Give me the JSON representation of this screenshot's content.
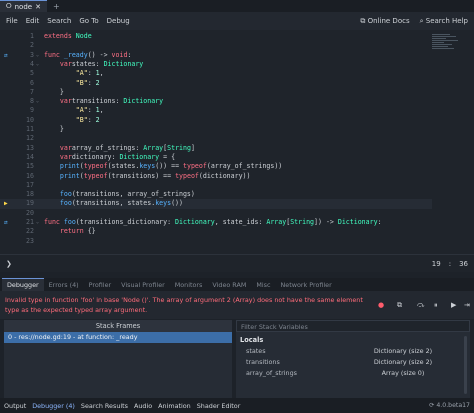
{
  "tab": {
    "title": "node"
  },
  "menu": {
    "items": [
      "File",
      "Edit",
      "Search",
      "Go To",
      "Debug"
    ],
    "online_docs": "Online Docs",
    "search_help": "Search Help"
  },
  "editor": {
    "lines": [
      {
        "n": "1",
        "tokens": [
          [
            "kw",
            "extends"
          ],
          [
            "",
            ""
          ],
          [
            "ty",
            "Node"
          ]
        ]
      },
      {
        "n": "2",
        "tokens": []
      },
      {
        "n": "3",
        "mark": "⇄",
        "fold": "v",
        "tokens": [
          [
            "kw",
            "func"
          ],
          [
            "",
            ""
          ],
          [
            "fn",
            "_ready"
          ],
          [
            "",
            "() -> "
          ],
          [
            "kw",
            "void"
          ],
          [
            "",
            ":"
          ]
        ]
      },
      {
        "n": "4",
        "fold": "v",
        "tokens": [
          [
            "",
            "    "
          ],
          [
            "kw",
            "var"
          ],
          [
            "",
            "states: "
          ],
          [
            "ty",
            "Dictionary"
          ],
          [
            "",
            ""
          ],
          [
            "",
            ""
          ],
          [
            "",
            ""
          ],
          [
            "",
            ""
          ],
          [
            "",
            ""
          ],
          [
            "",
            ""
          ],
          [
            "",
            ""
          ],
          [
            "",
            ""
          ],
          [
            "",
            ""
          ],
          [
            "",
            ""
          ],
          [
            "",
            ""
          ]
        ]
      },
      {
        "n": "5",
        "tokens": [
          [
            "",
            "        "
          ],
          [
            "st",
            "\"A\""
          ],
          [
            "",
            ": "
          ],
          [
            "nu",
            "1"
          ],
          [
            "",
            ","
          ]
        ]
      },
      {
        "n": "6",
        "tokens": [
          [
            "",
            "        "
          ],
          [
            "st",
            "\"B\""
          ],
          [
            "",
            ": "
          ],
          [
            "nu",
            "2"
          ]
        ]
      },
      {
        "n": "7",
        "tokens": [
          [
            "",
            "    }"
          ]
        ]
      },
      {
        "n": "8",
        "fold": "v",
        "tokens": [
          [
            "",
            "    "
          ],
          [
            "kw",
            "var"
          ],
          [
            "",
            "transitions: "
          ],
          [
            "ty",
            "Dictionary"
          ],
          [
            "",
            ""
          ]
        ]
      },
      {
        "n": "9",
        "tokens": [
          [
            "",
            "        "
          ],
          [
            "st",
            "\"A\""
          ],
          [
            "",
            ": "
          ],
          [
            "nu",
            "1"
          ],
          [
            "",
            ","
          ]
        ]
      },
      {
        "n": "10",
        "tokens": [
          [
            "",
            "        "
          ],
          [
            "st",
            "\"B\""
          ],
          [
            "",
            ": "
          ],
          [
            "nu",
            "2"
          ]
        ]
      },
      {
        "n": "11",
        "tokens": [
          [
            "",
            "    }"
          ]
        ]
      },
      {
        "n": "12",
        "tokens": []
      },
      {
        "n": "13",
        "tokens": [
          [
            "",
            "    "
          ],
          [
            "kw",
            "var"
          ],
          [
            "",
            "array_of_strings: "
          ],
          [
            "ty",
            "Array"
          ],
          [
            "",
            "["
          ],
          [
            "ty",
            "String"
          ],
          [
            "",
            "]"
          ]
        ]
      },
      {
        "n": "14",
        "tokens": [
          [
            "",
            "    "
          ],
          [
            "kw",
            "var"
          ],
          [
            "",
            "dictionary: "
          ],
          [
            "ty",
            "Dictionary"
          ]
        ]
      },
      {
        "n": "15",
        "tokens": [
          [
            "",
            "    "
          ],
          [
            "fn",
            "print"
          ],
          [
            "",
            "("
          ],
          [
            "kw",
            "typeof"
          ],
          [
            "",
            "(states."
          ],
          [
            "fn",
            "keys"
          ],
          [
            "",
            "()) == "
          ],
          [
            "kw",
            "typeof"
          ],
          [
            "",
            "(array_of_strings))"
          ]
        ]
      },
      {
        "n": "16",
        "tokens": [
          [
            "",
            "    "
          ],
          [
            "fn",
            "print"
          ],
          [
            "",
            "("
          ],
          [
            "kw",
            "typeof"
          ],
          [
            "",
            "(transitions) == "
          ],
          [
            "kw",
            "typeof"
          ],
          [
            "",
            "(dictionary))"
          ]
        ]
      },
      {
        "n": "17",
        "tokens": []
      },
      {
        "n": "18",
        "tokens": [
          [
            "",
            "    "
          ],
          [
            "fn",
            "foo"
          ],
          [
            "",
            "(transitions, array_of_strings)"
          ]
        ]
      },
      {
        "n": "19",
        "mark": "▶",
        "current": true,
        "tokens": [
          [
            "",
            "    "
          ],
          [
            "fn",
            "foo"
          ],
          [
            "",
            "(transitions, states."
          ],
          [
            "fn",
            "keys"
          ],
          [
            "",
            "())"
          ]
        ]
      },
      {
        "n": "20",
        "tokens": []
      },
      {
        "n": "21",
        "mark": "⇄",
        "fold": "v",
        "tokens": [
          [
            "kw",
            "func"
          ],
          [
            "",
            ""
          ],
          [
            "fn",
            "foo"
          ],
          [
            "",
            "(transitions_dictionary: "
          ],
          [
            "ty",
            "Dictionary"
          ],
          [
            "",
            ", state_ids: "
          ],
          [
            "ty",
            "Array"
          ],
          [
            "",
            "["
          ],
          [
            "ty",
            "String"
          ],
          [
            "",
            "]) -> "
          ],
          [
            "ty",
            "Dictionary"
          ],
          [
            "",
            ":"
          ]
        ]
      },
      {
        "n": "22",
        "tokens": [
          [
            "",
            "    "
          ],
          [
            "kw",
            "return"
          ],
          [
            "",
            ""
          ],
          [
            "",
            "{}"
          ]
        ]
      },
      {
        "n": "23",
        "tokens": []
      }
    ]
  },
  "status": {
    "line": "19",
    "col": "36"
  },
  "debugger_tabs": [
    "Debugger",
    "Errors (4)",
    "Profiler",
    "Visual Profiler",
    "Monitors",
    "Video RAM",
    "Misc",
    "Network Profiler"
  ],
  "error_message": "Invalid type in function 'foo' in base 'Node ()'. The array of argument 2 (Array) does not have the same element type as the expected typed array argument.",
  "stack": {
    "header": "Stack Frames",
    "frames": [
      "0 - res://node.gd:19 - at function: _ready"
    ]
  },
  "vars": {
    "filter_placeholder": "Filter Stack Variables",
    "locals_label": "Locals",
    "items": [
      {
        "name": "states",
        "value": "Dictionary (size 2)"
      },
      {
        "name": "transitions",
        "value": "Dictionary (size 2)"
      },
      {
        "name": "array_of_strings",
        "value": "Array (size 0)"
      }
    ]
  },
  "bottom_tabs": [
    "Output",
    "Debugger (4)",
    "Search Results",
    "Audio",
    "Animation",
    "Shader Editor"
  ],
  "version": "4.0.beta17"
}
